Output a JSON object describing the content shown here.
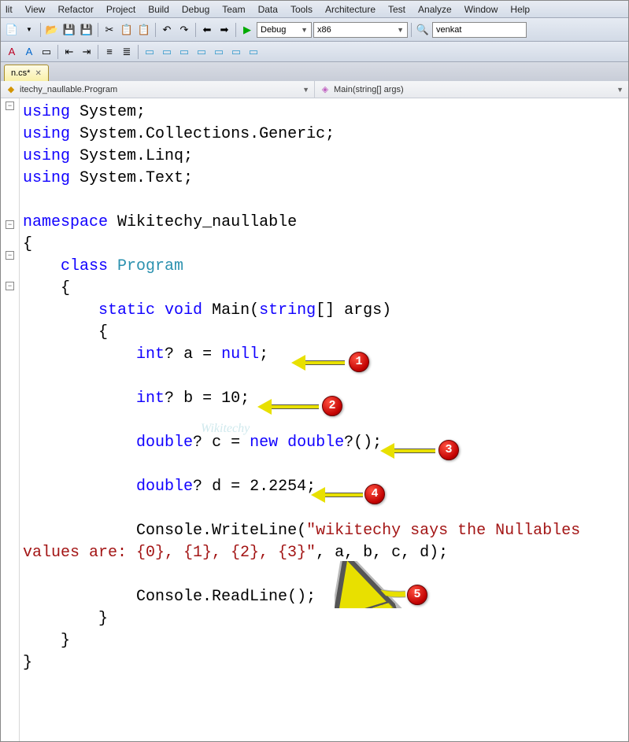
{
  "menu": [
    "lit",
    "View",
    "Refactor",
    "Project",
    "Build",
    "Debug",
    "Team",
    "Data",
    "Tools",
    "Architecture",
    "Test",
    "Analyze",
    "Window",
    "Help"
  ],
  "toolbar": {
    "config": "Debug",
    "platform": "x86",
    "search": "venkat"
  },
  "tab": {
    "name": "n.cs*"
  },
  "nav": {
    "left": "itechy_naullable.Program",
    "right": "Main(string[] args)"
  },
  "code": {
    "kw_using": "using",
    "sys": "System;",
    "sys_gen": "System.Collections.Generic;",
    "sys_linq": "System.Linq;",
    "sys_text": "System.Text;",
    "kw_namespace": "namespace",
    "ns_name": "Wikitechy_naullable",
    "brace_o": "{",
    "brace_c": "}",
    "kw_class": "class",
    "cls_program": "Program",
    "kw_static": "static",
    "kw_void": "void",
    "main_sig": "Main(",
    "kw_string": "string",
    "args": "[] args)",
    "kw_int": "int",
    "q": "?",
    "a_decl": " a = ",
    "kw_null": "null",
    "semi": ";",
    "b_decl": " b = 10;",
    "kw_double": "double",
    "c_decl": " c = ",
    "kw_new": "new",
    "dbl_paren": "?();",
    "d_decl": " d = 2.2254;",
    "console_wl": "Console.WriteLine(",
    "str_part": "\"wikitechy says the Nullables ",
    "line_wrap": "values are: {0}, {1}, {2}, {3}\"",
    "args_tail": ", a, b, c, d);",
    "console_rl": "Console.ReadLine();"
  },
  "bubbles": {
    "1": "1",
    "2": "2",
    "3": "3",
    "4": "4",
    "5": "5"
  },
  "watermark": "Wikitechy"
}
